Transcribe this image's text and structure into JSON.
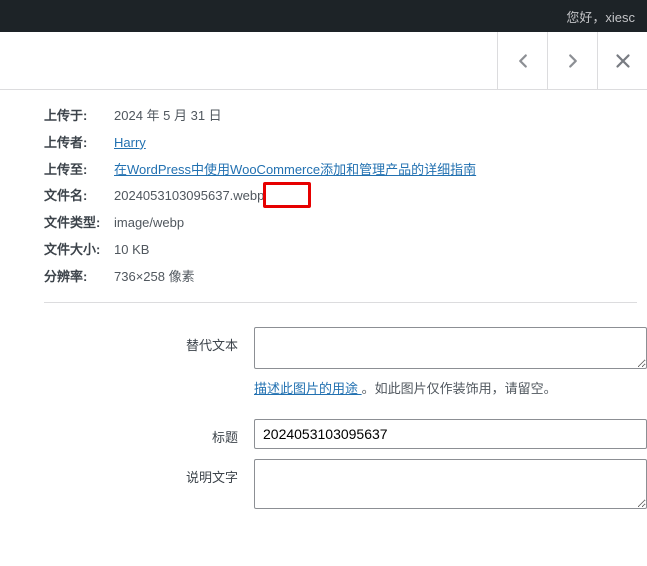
{
  "topbar": {
    "greeting": "您好，xiesc"
  },
  "meta": {
    "uploaded_on_label": "上传于:",
    "uploaded_on_value": "2024 年 5 月 31 日",
    "uploader_label": "上传者:",
    "uploader_value": "Harry",
    "uploaded_to_label": "上传至:",
    "uploaded_to_value": "在WordPress中使用WooCommerce添加和管理产品的详细指南",
    "filename_label": "文件名:",
    "filename_value": "2024053103095637.webp",
    "filetype_label": "文件类型:",
    "filetype_value": "image/webp",
    "filesize_label": "文件大小:",
    "filesize_value": "10 KB",
    "resolution_label": "分辨率:",
    "resolution_value": "736×258 像素"
  },
  "form": {
    "alt_label": "替代文本",
    "alt_help_link": "描述此图片的用途 ",
    "alt_help_rest": "。如此图片仅作装饰用，请留空。",
    "title_label": "标题",
    "title_value": "2024053103095637",
    "caption_label": "说明文字"
  }
}
